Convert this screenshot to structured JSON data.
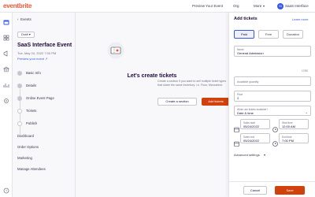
{
  "topbar": {
    "logo": "eventbrite",
    "preview_label": "Preview Your Event",
    "org_label": "Org",
    "more_label": "More",
    "avatar_initials": "SI",
    "user_name": "SaaS Interface"
  },
  "sidebar": {
    "back_label": "Events",
    "status": "Draft",
    "event_title": "SaaS Interface Event",
    "event_date": "Tue, May 24, 2022 7:00 PM",
    "preview_link": "Preview your event",
    "steps": [
      "Basic Info",
      "Details",
      "Online Event Page",
      "Tickets",
      "Publish"
    ],
    "nav": [
      "Dashboard",
      "Order Options",
      "Marketing",
      "Manage Attendees"
    ]
  },
  "main": {
    "empty_title": "Let's create tickets",
    "empty_desc_1": "Create a section if you want to sell multiple ticket types",
    "empty_desc_2": "that share the same inventory. i.e. Floor, Mezzanine.",
    "create_section_label": "Create a section",
    "add_tickets_label": "Add tickets"
  },
  "panel": {
    "title": "Add tickets",
    "learn_more": "Learn more",
    "ticket_types": [
      "Paid",
      "Free",
      "Donation"
    ],
    "name_label": "Name",
    "name_value": "General Admission",
    "name_counter": "17/50",
    "quantity_placeholder": "Available quantity",
    "price_label": "Price",
    "price_placeholder": "$",
    "when_label": "When are tickets available?",
    "when_value": "Date & time",
    "sales_start_label": "Sales start",
    "sales_start_value": "05/24/2022",
    "start_time_label": "Start time",
    "start_time_value": "12:00 AM",
    "sales_end_label": "Sales end",
    "sales_end_value": "05/24/2022",
    "end_time_label": "End time",
    "end_time_value": "7:00 PM",
    "advanced_label": "Advanced settings",
    "cancel_label": "Cancel",
    "save_label": "Save"
  },
  "colors": {
    "brand": "#f05537",
    "primary_action": "#d1410c",
    "link": "#3659e3"
  }
}
